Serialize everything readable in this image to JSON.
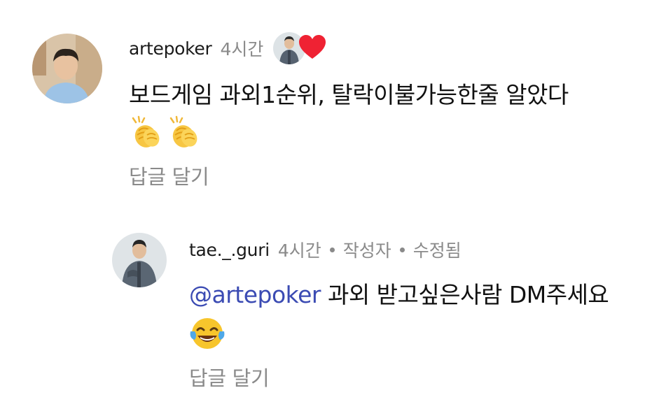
{
  "comment": {
    "username": "artepoker",
    "time": "4시간",
    "text": "보드게임 과외1순위, 탈락이불가능한줄 알았다",
    "emojis": [
      "clapping-hands",
      "clapping-hands"
    ],
    "reply_label": "답글 달기",
    "liked_by_author_icon": "heart-icon"
  },
  "reply": {
    "username": "tae._.guri",
    "time": "4시간",
    "author_tag": "작성자",
    "edited_tag": "수정됨",
    "mention": "@artepoker",
    "text": " 과외 받고싶은사람 DM주세요",
    "emojis": [
      "face-with-tears-of-joy"
    ],
    "reply_label": "답글 달기"
  },
  "colors": {
    "mention": "#3b4bb3",
    "muted": "#8a8a8a",
    "heart": "#ef2233"
  }
}
